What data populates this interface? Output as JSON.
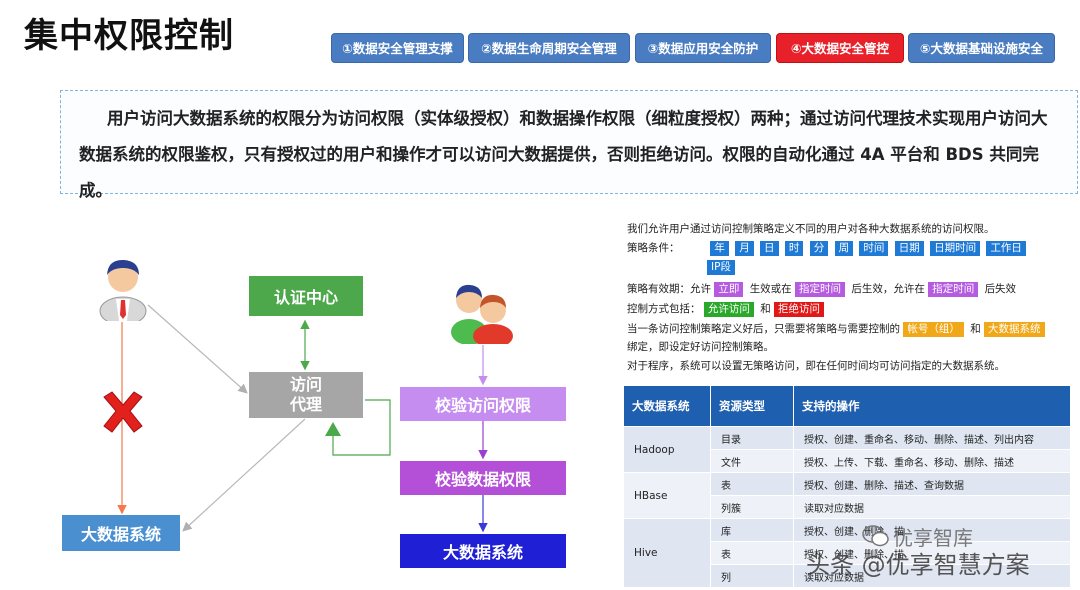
{
  "title": "集中权限控制",
  "tabs": [
    {
      "label": "①数据安全管理支撑",
      "active": false
    },
    {
      "label": "②数据生命周期安全管理",
      "active": false
    },
    {
      "label": "③数据应用安全防护",
      "active": false
    },
    {
      "label": "④大数据安全管控",
      "active": true
    },
    {
      "label": "⑤大数据基础设施安全",
      "active": false
    }
  ],
  "intro": "用户访问大数据系统的权限分为访问权限（实体级授权）和数据操作权限（细粒度授权）两种；通过访问代理技术实现用户访问大数据系统的权限鉴权，只有授权过的用户和操作才可以访问大数据提供，否则拒绝访问。权限的自动化通过 4A 平台和 BDS 共同完成。",
  "diagram": {
    "auth_center": "认证中心",
    "proxy_line1": "访问",
    "proxy_line2": "代理",
    "bigdata_left": "大数据系统",
    "check_access": "校验访问权限",
    "check_data": "校验数据权限",
    "bigdata_right": "大数据系统",
    "icons": [
      "single-user-icon",
      "user-group-icon",
      "deny-cross-icon"
    ]
  },
  "policy": {
    "line1": "我们允许用户通过访问控制策略定义不同的用户对各种大数据系统的访问权限。",
    "conditions_label": "策略条件：",
    "conditions": [
      "年",
      "月",
      "日",
      "时",
      "分",
      "周",
      "时间",
      "日期",
      "日期时间",
      "工作日",
      "IP段"
    ],
    "validity_a": "策略有效期：允许",
    "validity_tag1": "立即",
    "validity_b": "生效或在",
    "validity_tag2": "指定时间",
    "validity_c": "后生效，允许在",
    "validity_tag3": "指定时间",
    "validity_d": "后失效",
    "control_label": "控制方式包括：",
    "control_allow": "允许访问",
    "control_and": "和",
    "control_deny": "拒绝访问",
    "bind_a": "当一条访问控制策略定义好后，只需要将策略与需要控制的",
    "bind_tag1": "帐号（组）",
    "bind_and": "和",
    "bind_tag2": "大数据系统",
    "bind_b": "绑定，即设定好访问控制策略。",
    "program_line": "对于程序，系统可以设置无策略访问，即在任何时间均可访问指定的大数据系统。"
  },
  "table": {
    "headers": [
      "大数据系统",
      "资源类型",
      "支持的操作"
    ],
    "groups": [
      {
        "system": "Hadoop",
        "rows": [
          {
            "type": "目录",
            "ops": "授权、创建、重命名、移动、删除、描述、列出内容"
          },
          {
            "type": "文件",
            "ops": "授权、上传、下载、重命名、移动、删除、描述"
          }
        ]
      },
      {
        "system": "HBase",
        "rows": [
          {
            "type": "表",
            "ops": "授权、创建、删除、描述、查询数据"
          },
          {
            "type": "列簇",
            "ops": "读取对应数据"
          }
        ]
      },
      {
        "system": "Hive",
        "rows": [
          {
            "type": "库",
            "ops": "授权、创建、删除、描"
          },
          {
            "type": "表",
            "ops": "授权、创建、删除、描"
          },
          {
            "type": "列",
            "ops": "读取对应数据"
          }
        ]
      }
    ]
  },
  "watermark": {
    "line1": "优享智库",
    "line2": "头条 @优享智慧方案"
  }
}
